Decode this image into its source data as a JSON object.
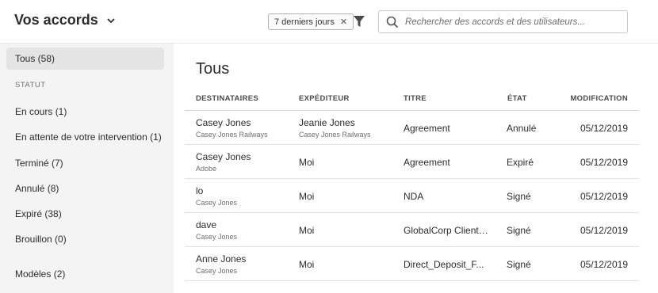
{
  "header": {
    "title": "Vos accords",
    "filter_chip": "7 derniers jours",
    "search_placeholder": "Rechercher des accords et des utilisateurs..."
  },
  "sidebar": {
    "all": "Tous (58)",
    "section_label": "STATUT",
    "items": [
      "En cours (1)",
      "En attente de votre intervention (1)",
      "Terminé (7)",
      "Annulé (8)",
      "Expiré (38)",
      "Brouillon (0)"
    ],
    "templates": "Modèles (2)"
  },
  "main": {
    "title": "Tous",
    "columns": [
      "DESTINATAIRES",
      "EXPÉDITEUR",
      "TITRE",
      "ÉTAT",
      "MODIFICATION"
    ],
    "rows": [
      {
        "recipient": "Casey Jones",
        "recipient_org": "Casey Jones Railways",
        "sender": "Jeanie Jones",
        "sender_org": "Casey Jones Railways",
        "title": "Agreement",
        "status": "Annulé",
        "modified": "05/12/2019"
      },
      {
        "recipient": "Casey Jones",
        "recipient_org": "Adobe",
        "sender": "Moi",
        "sender_org": "",
        "title": "Agreement",
        "status": "Expiré",
        "modified": "05/12/2019"
      },
      {
        "recipient": "lo",
        "recipient_org": "Casey Jones",
        "sender": "Moi",
        "sender_org": "",
        "title": "NDA",
        "status": "Signé",
        "modified": "05/12/2019"
      },
      {
        "recipient": "dave",
        "recipient_org": "Casey Jones",
        "sender": "Moi",
        "sender_org": "",
        "title": "GlobalCorp Client ...",
        "status": "Signé",
        "modified": "05/12/2019"
      },
      {
        "recipient": "Anne Jones",
        "recipient_org": "Casey Jones",
        "sender": "Moi",
        "sender_org": "",
        "title": "Direct_Deposit_F...",
        "status": "Signé",
        "modified": "05/12/2019"
      }
    ]
  }
}
